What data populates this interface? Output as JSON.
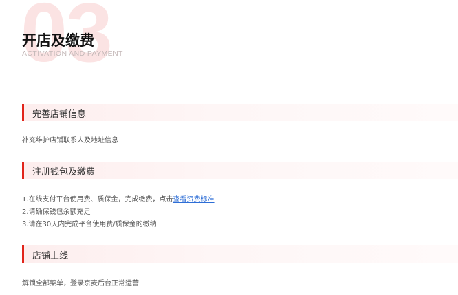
{
  "header": {
    "number": "03",
    "title": "开店及缴费",
    "subtitle": "ACTIVATION AND PAYMENT"
  },
  "sections": [
    {
      "title": "完善店铺信息",
      "lines": [
        "补充维护店铺联系人及地址信息"
      ]
    },
    {
      "title": "注册钱包及缴费",
      "line1_prefix": "1.在线支付平台使用费、质保金，完成缴费，点击",
      "line1_link": "查看资费标准",
      "line2": "2.请确保钱包余额充足",
      "line3": "3.请在30天内完成平台使用费/质保金的缴纳"
    },
    {
      "title": "店铺上线",
      "lines": [
        "解锁全部菜单，登录京麦后台正常运营"
      ]
    }
  ],
  "colors": {
    "accent": "#e1251b",
    "link": "#2e6ed6",
    "watermark": "#fbe3e3"
  }
}
